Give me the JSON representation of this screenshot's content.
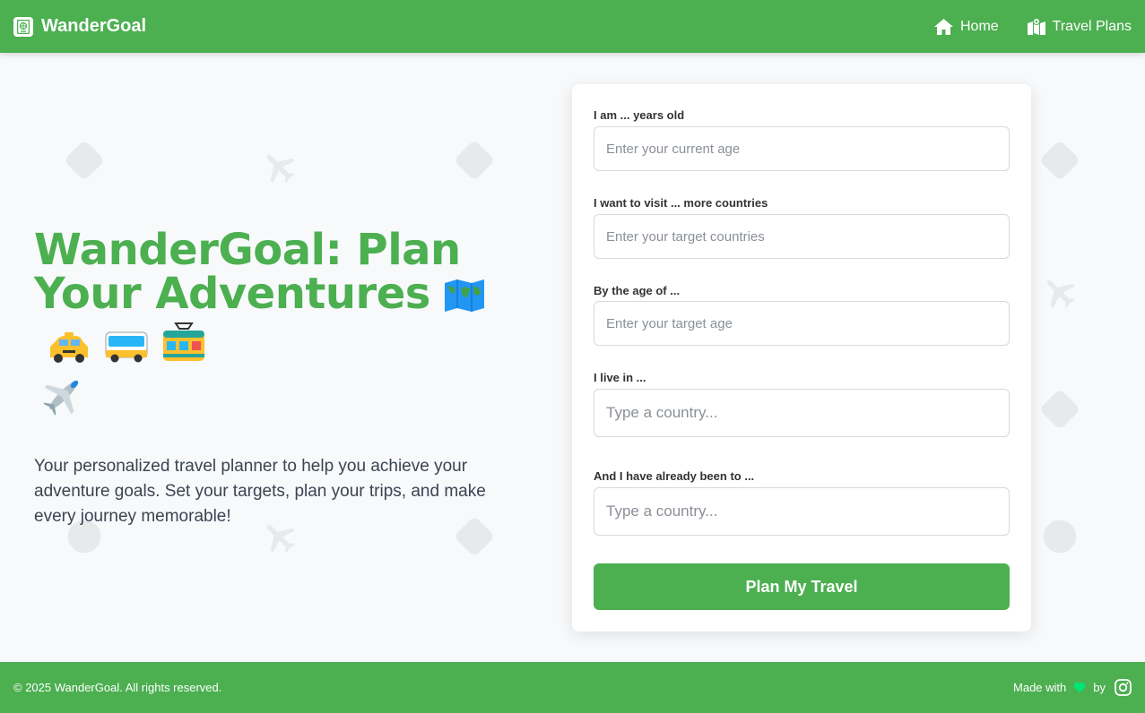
{
  "header": {
    "brand": "WanderGoal",
    "nav": [
      {
        "label": "Home",
        "icon": "home-icon"
      },
      {
        "label": "Travel Plans",
        "icon": "map-icon"
      }
    ]
  },
  "hero": {
    "title": "WanderGoal: Plan Your Adventures",
    "emojis": [
      "world-map",
      "taxi",
      "bus",
      "tram",
      "airplane"
    ],
    "description": "Your personalized travel planner to help you achieve your adventure goals. Set your targets, plan your trips, and make every journey memorable!"
  },
  "form": {
    "age_label": "I am ... years old",
    "age_placeholder": "Enter your current age",
    "countries_label": "I want to visit ... more countries",
    "countries_placeholder": "Enter your target countries",
    "target_age_label": "By the age of ...",
    "target_age_placeholder": "Enter your target age",
    "live_label": "I live in ...",
    "live_placeholder": "Type a country...",
    "visited_label": "And I have already been to ...",
    "visited_placeholder": "Type a country...",
    "submit_label": "Plan My Travel"
  },
  "footer": {
    "copyright": "© 2025 WanderGoal. All rights reserved.",
    "made_with": "Made with",
    "by": "by",
    "heart_color": "#00e676",
    "social_icon": "instagram-icon"
  },
  "colors": {
    "brand": "#4caf50",
    "background": "#f7f9fb",
    "text": "#3b4452"
  }
}
